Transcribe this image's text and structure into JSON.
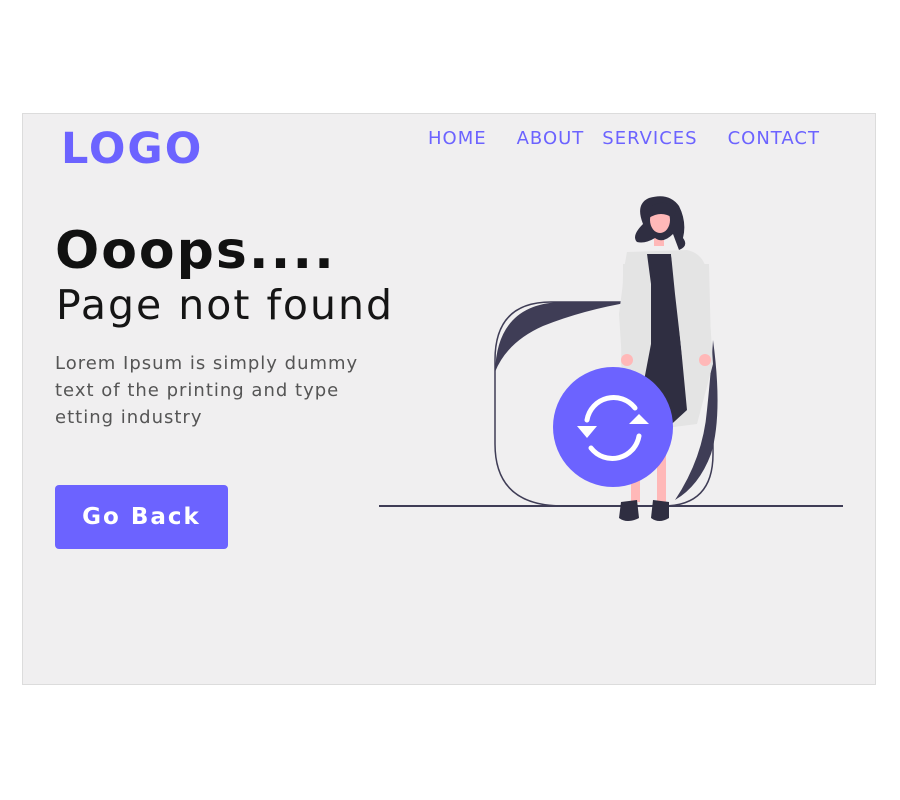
{
  "header": {
    "logo": "LOGO",
    "nav": {
      "home": "HOME",
      "about": "ABOUT",
      "services": "SERVICES",
      "contact": "CONTACT"
    }
  },
  "main": {
    "headline": "Ooops....",
    "subheadline": "Page not found",
    "body": "Lorem Ipsum is simply dummy text of the printing and type etting industry",
    "go_back_label": "Go Back"
  },
  "illustration": {
    "icon": "refresh-icon"
  },
  "colors": {
    "accent": "#6c63ff",
    "background": "#f0eff0",
    "dark": "#3f3d56",
    "text": "#111111"
  }
}
